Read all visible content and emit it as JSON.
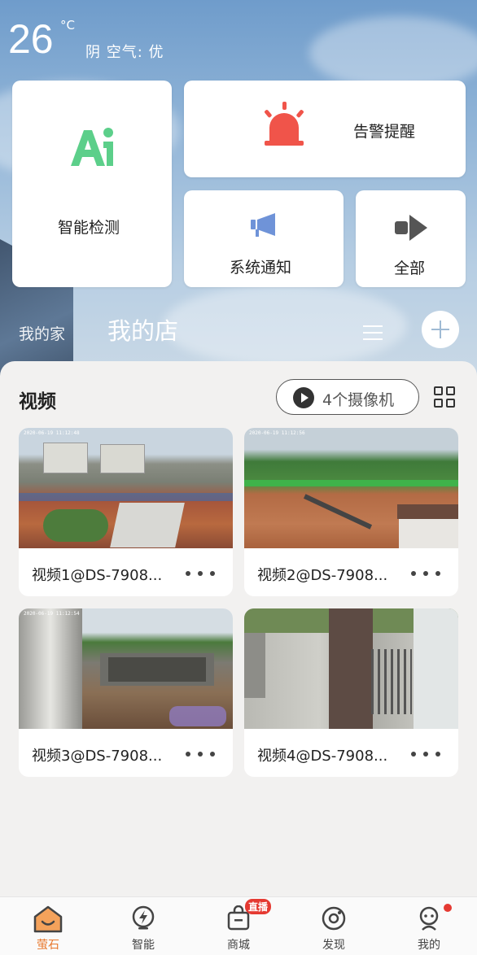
{
  "weather": {
    "temperature": "26",
    "unit": "°C",
    "condition": "阴 空气: 优"
  },
  "quick_actions": {
    "smart_detect": {
      "label": "智能检测",
      "icon": "ai-icon"
    },
    "alarm": {
      "label": "告警提醒",
      "icon": "alarm-siren-icon"
    },
    "system_notice": {
      "label": "系统通知",
      "icon": "megaphone-icon"
    },
    "all": {
      "label": "全部",
      "icon": "forward-arrow-icon"
    }
  },
  "home_tabs": {
    "home": "我的家",
    "store": "我的店"
  },
  "video_section": {
    "title": "视频",
    "camera_count_label": "4个摄像机",
    "videos": [
      {
        "name": "视频1@DS-7908...",
        "timestamp": "2020-06-19 11:12:48"
      },
      {
        "name": "视频2@DS-7908...",
        "timestamp": "2020-06-19 11:12:56"
      },
      {
        "name": "视频3@DS-7908...",
        "timestamp": "2020-06-19 11:12:54"
      },
      {
        "name": "视频4@DS-7908...",
        "timestamp": ""
      }
    ]
  },
  "bottom_nav": {
    "items": [
      {
        "label": "萤石",
        "icon": "home-icon",
        "active": true
      },
      {
        "label": "智能",
        "icon": "smart-bolt-icon"
      },
      {
        "label": "商城",
        "icon": "shopping-bag-icon",
        "badge": "直播"
      },
      {
        "label": "发现",
        "icon": "discover-icon"
      },
      {
        "label": "我的",
        "icon": "profile-icon"
      }
    ]
  },
  "colors": {
    "accent": "#e8782c",
    "ai_green": "#5ccf8a",
    "alarm_red": "#f0544a",
    "notice_blue": "#6f93d8"
  }
}
